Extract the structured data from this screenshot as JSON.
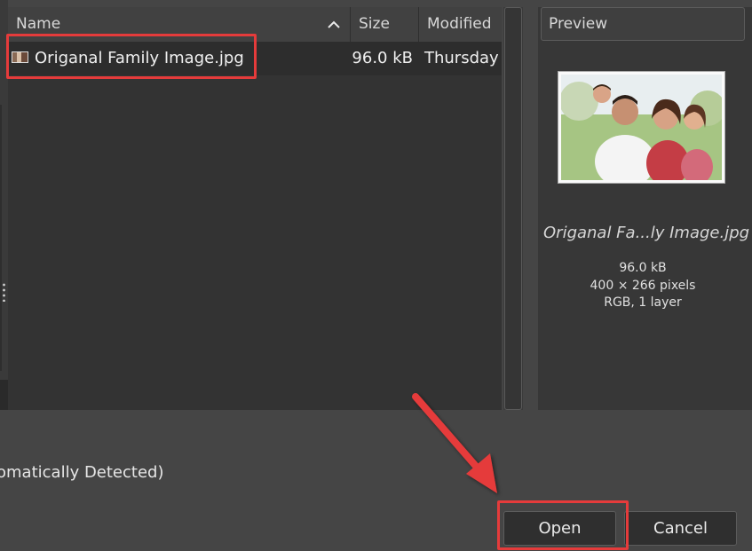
{
  "columns": {
    "name": "Name",
    "size": "Size",
    "modified": "Modified"
  },
  "files": [
    {
      "name": "Origanal Family Image.jpg",
      "size": "96.0 kB",
      "modified": "Thursday"
    }
  ],
  "preview": {
    "title": "Preview",
    "filename": "Origanal Fa...ly Image.jpg",
    "filesize": "96.0 kB",
    "dimensions": "400 × 266 pixels",
    "info": "RGB, 1 layer"
  },
  "filetype_label": "omatically Detected)",
  "buttons": {
    "open": "Open",
    "cancel": "Cancel"
  },
  "colors": {
    "annotation": "#e53b3b",
    "background": "#454545",
    "list_bg": "#333333"
  },
  "icons": {
    "sort": "chevron-up-icon",
    "file": "image-file-icon"
  }
}
